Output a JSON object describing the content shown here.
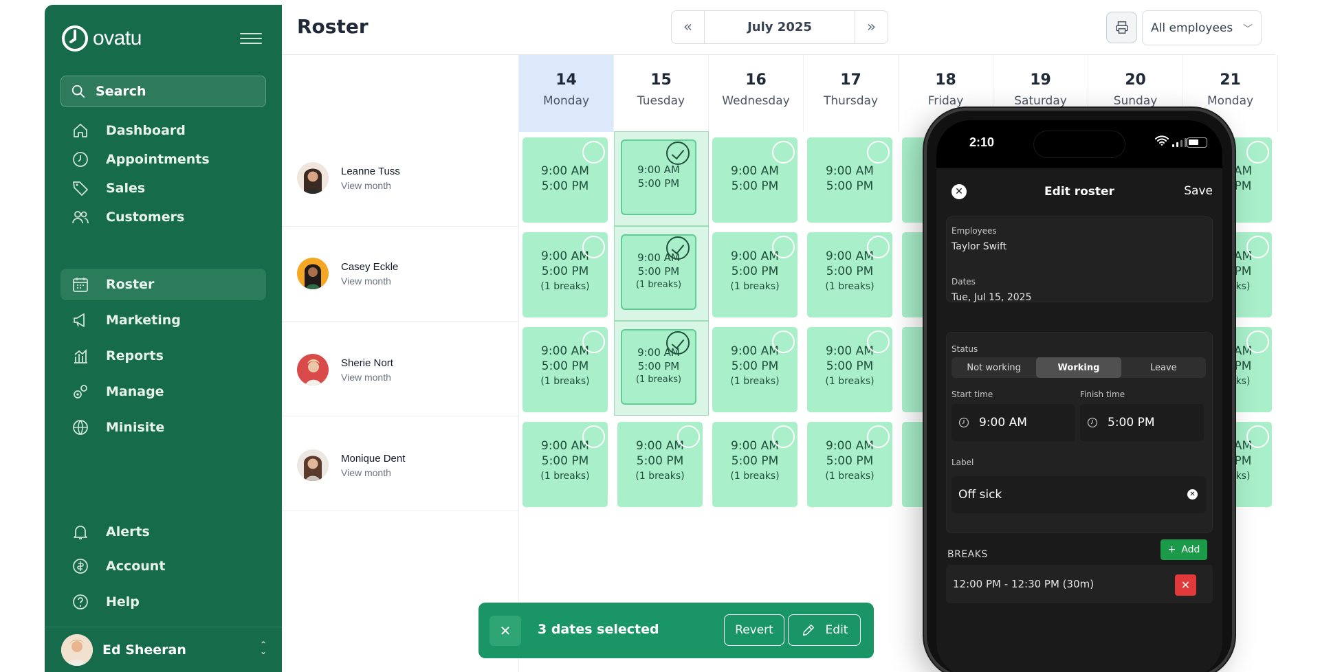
{
  "brand": {
    "name": "ovatu"
  },
  "sidebar": {
    "search_label": "Search",
    "items": [
      {
        "label": "Dashboard",
        "icon": "home-icon"
      },
      {
        "label": "Appointments",
        "icon": "clock-icon"
      },
      {
        "label": "Sales",
        "icon": "tag-icon"
      },
      {
        "label": "Customers",
        "icon": "users-icon"
      },
      {
        "label": "Roster",
        "icon": "calendar-icon"
      },
      {
        "label": "Marketing",
        "icon": "megaphone-icon"
      },
      {
        "label": "Reports",
        "icon": "chart-icon"
      },
      {
        "label": "Manage",
        "icon": "cogs-icon"
      },
      {
        "label": "Minisite",
        "icon": "globe-icon"
      }
    ],
    "bottom_items": [
      {
        "label": "Alerts",
        "icon": "bell-icon"
      },
      {
        "label": "Account",
        "icon": "account-icon"
      },
      {
        "label": "Help",
        "icon": "help-icon"
      }
    ],
    "user_name": "Ed Sheeran"
  },
  "header": {
    "title": "Roster",
    "date_label": "July 2025",
    "employee_filter": "All employees"
  },
  "days": [
    {
      "num": "14",
      "name": "Monday"
    },
    {
      "num": "15",
      "name": "Tuesday"
    },
    {
      "num": "16",
      "name": "Wednesday"
    },
    {
      "num": "17",
      "name": "Thursday"
    },
    {
      "num": "18",
      "name": "Friday"
    },
    {
      "num": "19",
      "name": "Saturday"
    },
    {
      "num": "20",
      "name": "Sunday"
    },
    {
      "num": "21",
      "name": "Monday"
    }
  ],
  "employees": [
    {
      "name": "Leanne Tuss",
      "link": "View month"
    },
    {
      "name": "Casey Eckle",
      "link": "View month"
    },
    {
      "name": "Sherie Nort",
      "link": "View month"
    },
    {
      "name": "Monique Dent",
      "link": "View month"
    }
  ],
  "shift": {
    "start": "9:00 AM",
    "end": "5:00 PM",
    "breaks": "(1 breaks)"
  },
  "partial_shift": {
    "end": "PM",
    "breaks": "ks)"
  },
  "selection_bar": {
    "count_text": "3 dates selected",
    "revert": "Revert",
    "edit": "Edit"
  },
  "phone": {
    "time": "2:10",
    "title": "Edit roster",
    "save": "Save",
    "employees_label": "Employees",
    "employees_value": "Taylor Swift",
    "dates_label": "Dates",
    "dates_value": "Tue, Jul 15, 2025",
    "status_label": "Status",
    "status_options": [
      "Not working",
      "Working",
      "Leave"
    ],
    "status_selected": "Working",
    "start_label": "Start time",
    "start_value": "9:00 AM",
    "finish_label": "Finish time",
    "finish_value": "5:00 PM",
    "label_label": "Label",
    "label_value": "Off sick",
    "breaks_label": "BREAKS",
    "add_label": "Add",
    "break_value": "12:00 PM - 12:30 PM (30m)"
  },
  "colors": {
    "sidebar": "#166b4b",
    "shift": "#a8efca",
    "accent": "#199566",
    "today": "#dbe9fb"
  }
}
